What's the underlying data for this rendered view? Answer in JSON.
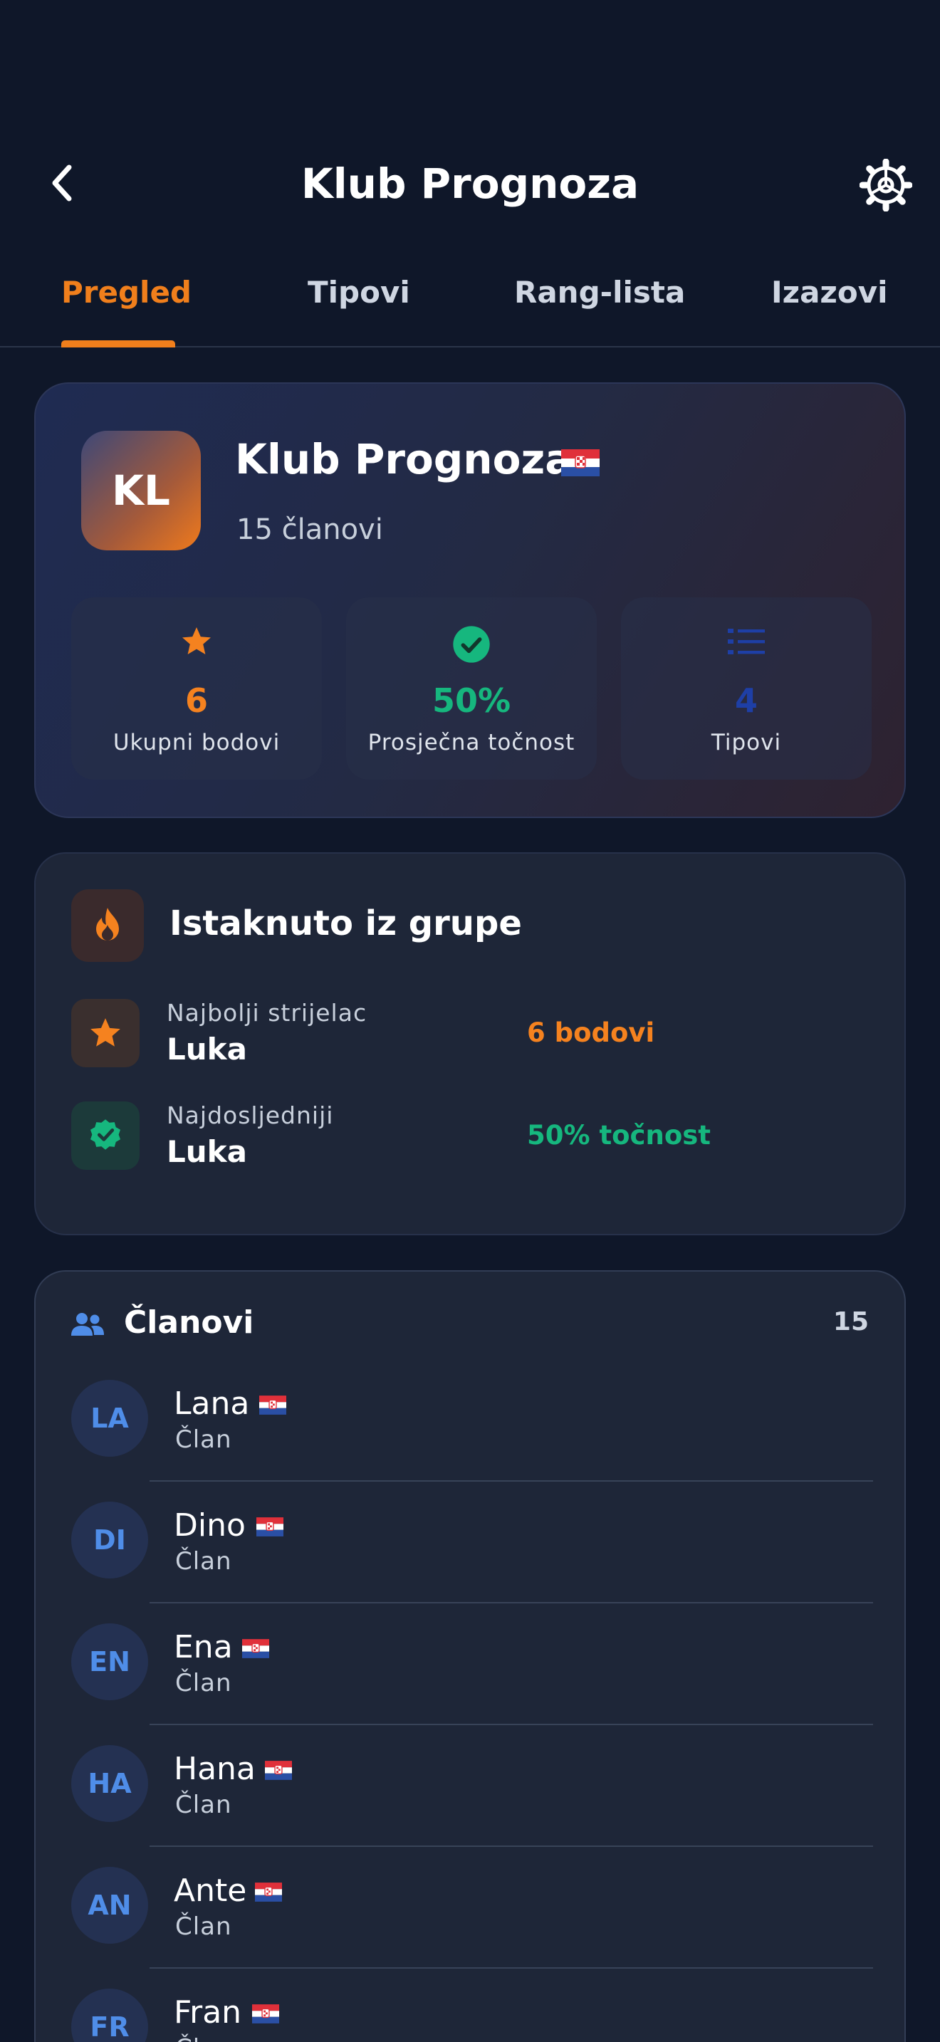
{
  "header": {
    "title": "Klub Prognoza"
  },
  "tabs": [
    {
      "label": "Pregled",
      "active": true
    },
    {
      "label": "Tipovi",
      "active": false
    },
    {
      "label": "Rang-lista",
      "active": false
    },
    {
      "label": "Izazovi",
      "active": false
    }
  ],
  "hero": {
    "initials": "KL",
    "name": "Klub Prognoza",
    "members": "15 članovi",
    "stats": [
      {
        "icon": "star-icon",
        "value": "6",
        "label": "Ukupni bodovi",
        "color": "#f5821f"
      },
      {
        "icon": "check-circle-icon",
        "value": "50%",
        "label": "Prosječna točnost",
        "color": "#16b77e"
      },
      {
        "icon": "list-icon",
        "value": "4",
        "label": "Tipovi",
        "color": "#1e3fa6"
      }
    ]
  },
  "highlights": {
    "title": "Istaknuto iz grupe",
    "items": [
      {
        "icon": "star-icon",
        "label": "Najbolji strijelac",
        "name": "Luka",
        "value": "6 bodovi",
        "color": "#f5821f"
      },
      {
        "icon": "verified-badge-icon",
        "label": "Najdosljedniji",
        "name": "Luka",
        "value": "50% točnost",
        "color": "#16b77e"
      }
    ]
  },
  "members_section": {
    "title": "Članovi",
    "count": "15",
    "items": [
      {
        "initials": "LA",
        "name": "Lana",
        "role": "Član"
      },
      {
        "initials": "DI",
        "name": "Dino",
        "role": "Član"
      },
      {
        "initials": "EN",
        "name": "Ena",
        "role": "Član"
      },
      {
        "initials": "HA",
        "name": "Hana",
        "role": "Član"
      },
      {
        "initials": "AN",
        "name": "Ante",
        "role": "Član"
      },
      {
        "initials": "FR",
        "name": "Fran",
        "role": "Član"
      }
    ]
  },
  "colors": {
    "background": "#0f1729",
    "accent": "#f07f1c",
    "success": "#16b77e",
    "card": "#1e2638",
    "avatar_text": "#4f8de8"
  }
}
